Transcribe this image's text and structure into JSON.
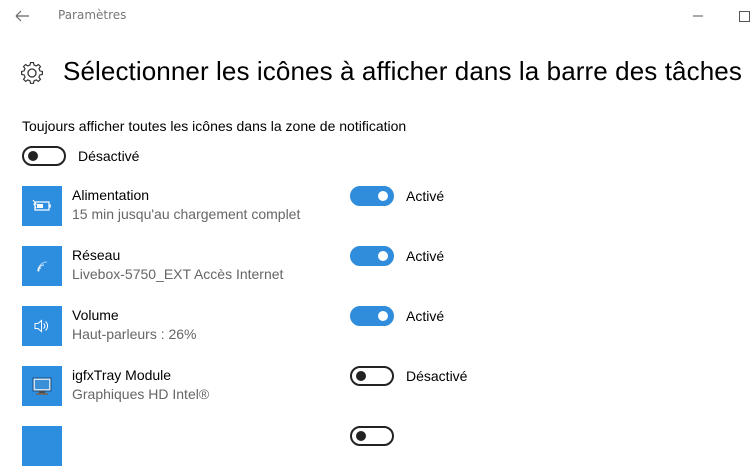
{
  "window": {
    "title": "Paramètres"
  },
  "header": {
    "title": "Sélectionner les icônes à afficher dans la barre des tâches"
  },
  "global_setting": {
    "label": "Toujours afficher toutes les icônes dans la zone de notification",
    "state": "off",
    "state_label": "Désactivé"
  },
  "items": [
    {
      "name": "Alimentation",
      "subtitle": "15 min jusqu'au chargement complet",
      "state": "on",
      "state_label": "Activé",
      "icon": "battery-icon"
    },
    {
      "name": "Réseau",
      "subtitle": "Livebox-5750_EXT Accès Internet",
      "state": "on",
      "state_label": "Activé",
      "icon": "wifi-icon"
    },
    {
      "name": "Volume",
      "subtitle": "Haut-parleurs : 26%",
      "state": "on",
      "state_label": "Activé",
      "icon": "speaker-icon"
    },
    {
      "name": "igfxTray Module",
      "subtitle": "Graphiques HD Intel®",
      "state": "off",
      "state_label": "Désactivé",
      "icon": "intel-graphics-icon"
    }
  ],
  "colors": {
    "accent": "#2f8ddb",
    "icon_tile": "#2d8ee0"
  }
}
